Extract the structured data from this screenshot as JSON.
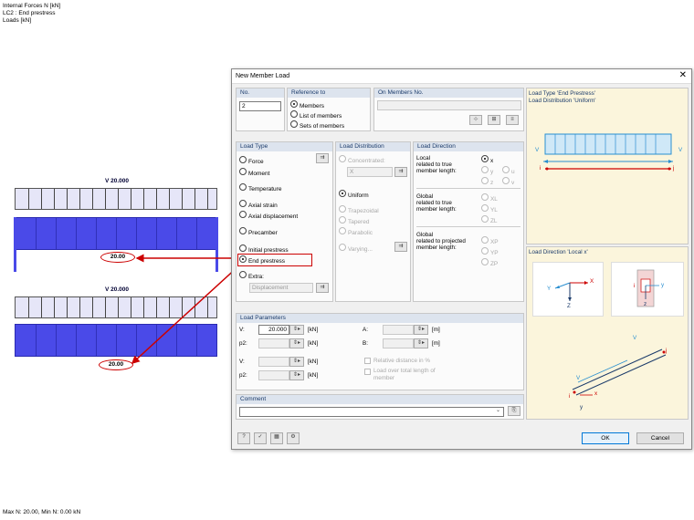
{
  "info": {
    "line1": "Internal Forces N [kN]",
    "line2": "LC2 : End prestress",
    "line3": "Loads [kN]",
    "footer": "Max N: 20.00, Min N: 0.00 kN"
  },
  "diagram": {
    "load_label_1": "V 20.000",
    "load_label_2": "V 20.000",
    "result_1": "20.00",
    "result_2": "20.00",
    "highlight_color": "#cc0000",
    "beam_color": "#4a4ae8"
  },
  "dialog": {
    "title": "New Member Load",
    "no": {
      "label": "No.",
      "value": "2"
    },
    "reference": {
      "header": "Reference to",
      "options": [
        "Members",
        "List of members",
        "Sets of members"
      ],
      "selected": "Members"
    },
    "on_members": {
      "header": "On Members No.",
      "value": ""
    },
    "load_type": {
      "header": "Load Type",
      "options": [
        "Force",
        "Moment",
        "Temperature",
        "Axial strain",
        "Axial displacement",
        "Precamber",
        "Initial prestress",
        "End prestress",
        "Extra:"
      ],
      "selected": "End prestress",
      "extra_value": "Displacement"
    },
    "load_distribution": {
      "header": "Load Distribution",
      "concentrated": "Concentrated:",
      "concentrated_value": "X",
      "options": [
        "Uniform",
        "Trapezoidal",
        "Tapered",
        "Parabolic",
        "Varying..."
      ],
      "selected": "Uniform"
    },
    "load_direction": {
      "header": "Load Direction",
      "local_label": "Local\nrelated to true\nmember length:",
      "global_true_label": "Global\nrelated to true\nmember length:",
      "global_proj_label": "Global\nrelated to projected\nmember length:",
      "local_options": [
        "x",
        "y",
        "z",
        "u",
        "v"
      ],
      "global_true_options": [
        "XL",
        "YL",
        "ZL"
      ],
      "global_proj_options": [
        "XP",
        "YP",
        "ZP"
      ],
      "selected": "x"
    },
    "load_parameters": {
      "header": "Load Parameters",
      "V_label": "V:",
      "V_value": "20.000",
      "unit_kN": "[kN]",
      "p2_label": "p2:",
      "V2_label": "V:",
      "p22_label": "p2:",
      "A_label": "A:",
      "B_label": "B:",
      "unit_m": "[m]",
      "relative": "Relative distance in %",
      "load_over": "Load over total length of member"
    },
    "comment": {
      "header": "Comment",
      "value": ""
    },
    "preview": {
      "title1": "Load Type 'End Prestress'",
      "title2": "Load Distribution 'Uniform'",
      "dir_title": "Load Direction 'Local x'",
      "v": "V",
      "i": "i",
      "j": "j",
      "X": "X",
      "Y": "Y",
      "Z": "Z",
      "x": "x",
      "y": "y",
      "z": "z"
    },
    "ok": "OK",
    "cancel": "Cancel"
  }
}
